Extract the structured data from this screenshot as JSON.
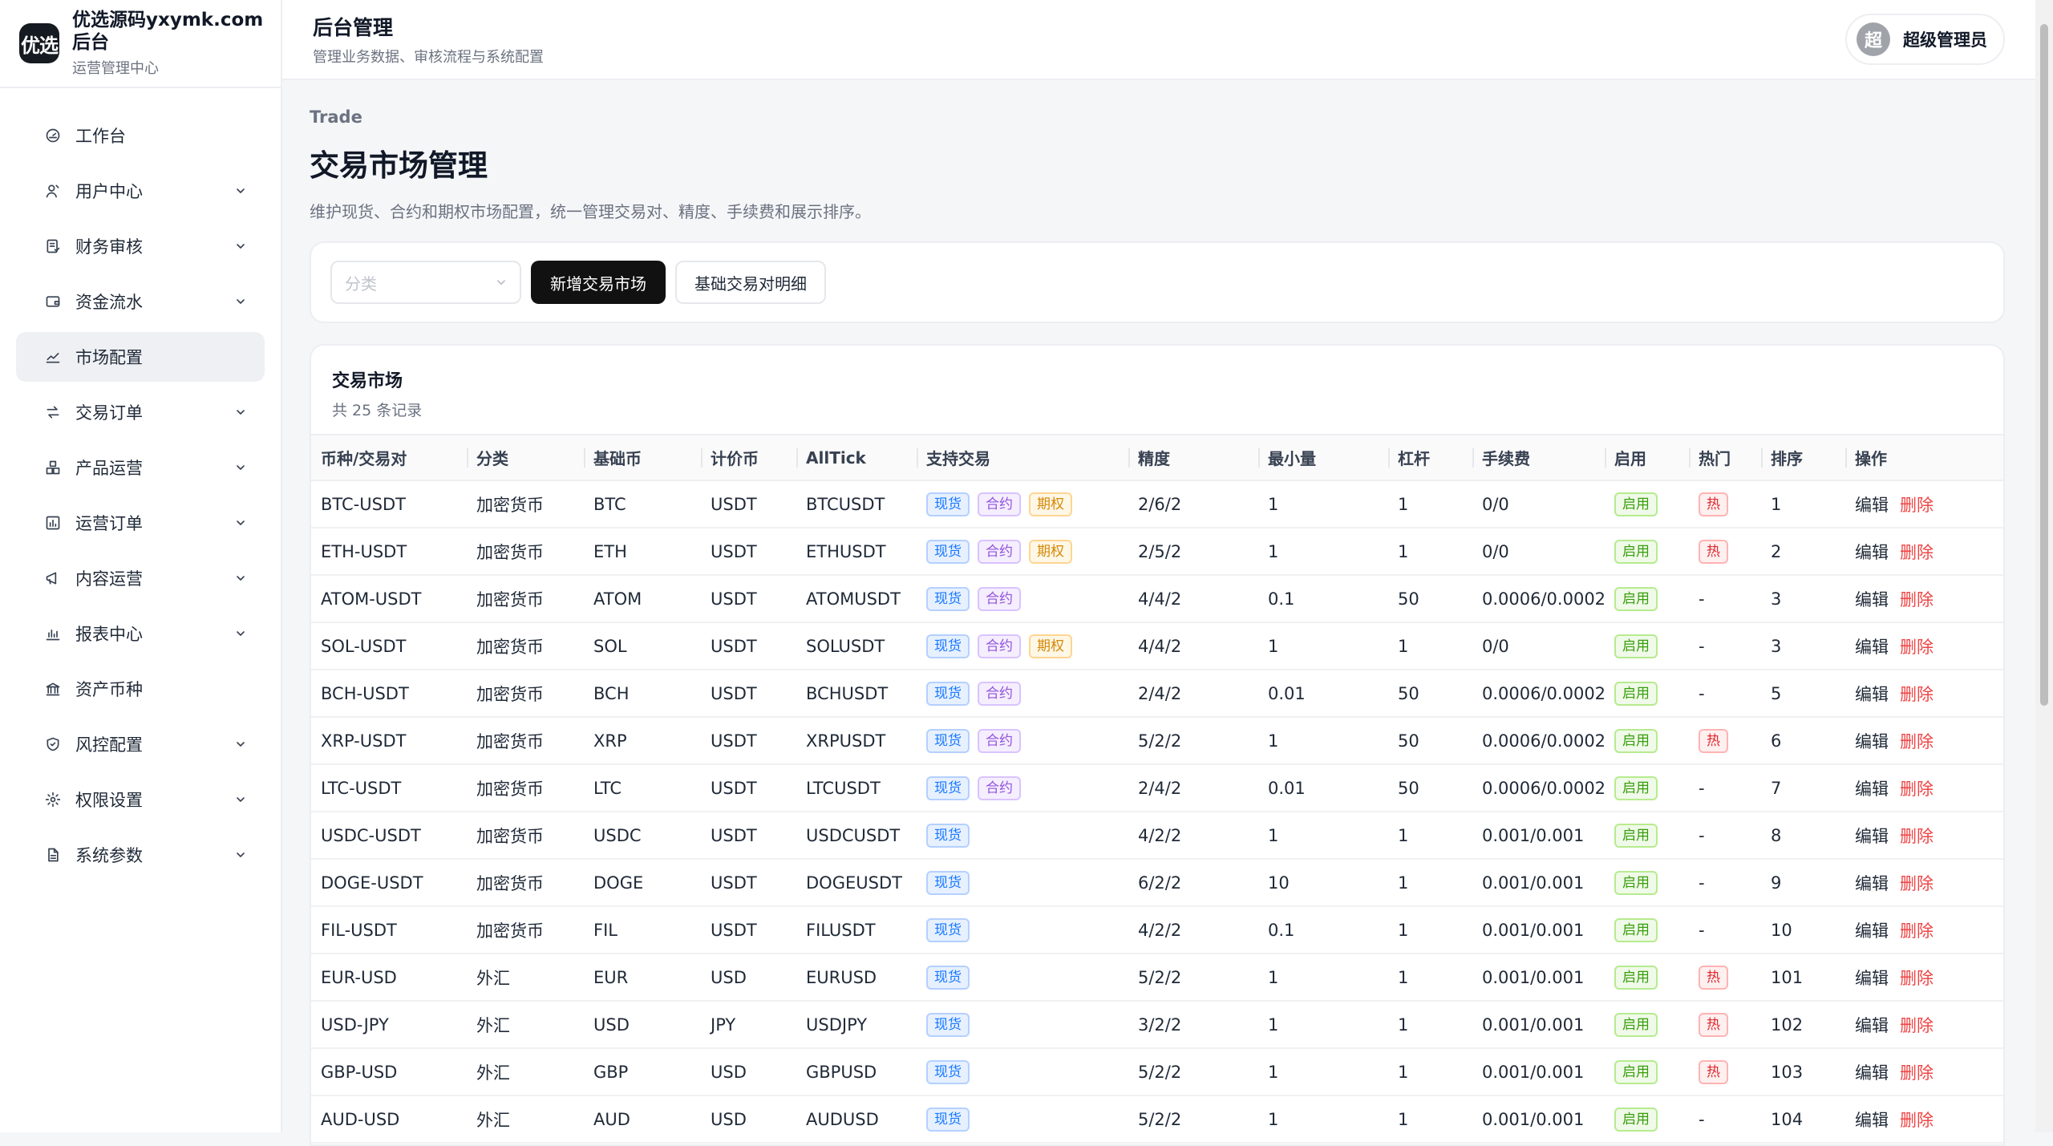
{
  "brand": {
    "logo": "优选",
    "title": "优选源码yxymk.com后台",
    "subtitle": "运营管理中心"
  },
  "nav": [
    {
      "label": "工作台",
      "icon": "dashboard-icon",
      "expandable": false,
      "active": false
    },
    {
      "label": "用户中心",
      "icon": "user-icon",
      "expandable": true,
      "active": false
    },
    {
      "label": "财务审核",
      "icon": "finance-icon",
      "expandable": true,
      "active": false
    },
    {
      "label": "资金流水",
      "icon": "wallet-icon",
      "expandable": true,
      "active": false
    },
    {
      "label": "市场配置",
      "icon": "chart-line-icon",
      "expandable": false,
      "active": true
    },
    {
      "label": "交易订单",
      "icon": "swap-icon",
      "expandable": true,
      "active": false
    },
    {
      "label": "产品运营",
      "icon": "boxes-icon",
      "expandable": true,
      "active": false
    },
    {
      "label": "运营订单",
      "icon": "order-chart-icon",
      "expandable": true,
      "active": false
    },
    {
      "label": "内容运营",
      "icon": "megaphone-icon",
      "expandable": true,
      "active": false
    },
    {
      "label": "报表中心",
      "icon": "bar-chart-icon",
      "expandable": true,
      "active": false
    },
    {
      "label": "资产币种",
      "icon": "bank-icon",
      "expandable": false,
      "active": false
    },
    {
      "label": "风控配置",
      "icon": "shield-icon",
      "expandable": true,
      "active": false
    },
    {
      "label": "权限设置",
      "icon": "gear-icon",
      "expandable": true,
      "active": false
    },
    {
      "label": "系统参数",
      "icon": "document-icon",
      "expandable": true,
      "active": false
    }
  ],
  "topbar": {
    "title": "后台管理",
    "subtitle": "管理业务数据、审核流程与系统配置",
    "avatar": "超",
    "user": "超级管理员"
  },
  "page": {
    "crumb": "Trade",
    "title": "交易市场管理",
    "desc": "维护现货、合约和期权市场配置，统一管理交易对、精度、手续费和展示排序。"
  },
  "toolbar": {
    "category_placeholder": "分类",
    "add_label": "新增交易市场",
    "detail_label": "基础交易对明细"
  },
  "card": {
    "title": "交易市场",
    "count": "共 25 条记录"
  },
  "columns": [
    "币种/交易对",
    "分类",
    "基础币",
    "计价币",
    "AllTick",
    "支持交易",
    "精度",
    "最小量",
    "杠杆",
    "手续费",
    "启用",
    "热门",
    "排序",
    "操作"
  ],
  "labels": {
    "spot": "现货",
    "futures": "合约",
    "options": "期权",
    "enabled": "启用",
    "hot": "热",
    "edit": "编辑",
    "delete": "删除",
    "none": "-"
  },
  "rows": [
    {
      "pair": "BTC-USDT",
      "cat": "加密货币",
      "base": "BTC",
      "quote": "USDT",
      "alltick": "BTCUSDT",
      "trade": [
        "spot",
        "futures",
        "options"
      ],
      "prec": "2/6/2",
      "min": "1",
      "lev": "1",
      "fee": "0/0",
      "hot": true,
      "sort": "1"
    },
    {
      "pair": "ETH-USDT",
      "cat": "加密货币",
      "base": "ETH",
      "quote": "USDT",
      "alltick": "ETHUSDT",
      "trade": [
        "spot",
        "futures",
        "options"
      ],
      "prec": "2/5/2",
      "min": "1",
      "lev": "1",
      "fee": "0/0",
      "hot": true,
      "sort": "2"
    },
    {
      "pair": "ATOM-USDT",
      "cat": "加密货币",
      "base": "ATOM",
      "quote": "USDT",
      "alltick": "ATOMUSDT",
      "trade": [
        "spot",
        "futures"
      ],
      "prec": "4/4/2",
      "min": "0.1",
      "lev": "50",
      "fee": "0.0006/0.0002",
      "hot": false,
      "sort": "3"
    },
    {
      "pair": "SOL-USDT",
      "cat": "加密货币",
      "base": "SOL",
      "quote": "USDT",
      "alltick": "SOLUSDT",
      "trade": [
        "spot",
        "futures",
        "options"
      ],
      "prec": "4/4/2",
      "min": "1",
      "lev": "1",
      "fee": "0/0",
      "hot": false,
      "sort": "3"
    },
    {
      "pair": "BCH-USDT",
      "cat": "加密货币",
      "base": "BCH",
      "quote": "USDT",
      "alltick": "BCHUSDT",
      "trade": [
        "spot",
        "futures"
      ],
      "prec": "2/4/2",
      "min": "0.01",
      "lev": "50",
      "fee": "0.0006/0.0002",
      "hot": false,
      "sort": "5"
    },
    {
      "pair": "XRP-USDT",
      "cat": "加密货币",
      "base": "XRP",
      "quote": "USDT",
      "alltick": "XRPUSDT",
      "trade": [
        "spot",
        "futures"
      ],
      "prec": "5/2/2",
      "min": "1",
      "lev": "50",
      "fee": "0.0006/0.0002",
      "hot": true,
      "sort": "6"
    },
    {
      "pair": "LTC-USDT",
      "cat": "加密货币",
      "base": "LTC",
      "quote": "USDT",
      "alltick": "LTCUSDT",
      "trade": [
        "spot",
        "futures"
      ],
      "prec": "2/4/2",
      "min": "0.01",
      "lev": "50",
      "fee": "0.0006/0.0002",
      "hot": false,
      "sort": "7"
    },
    {
      "pair": "USDC-USDT",
      "cat": "加密货币",
      "base": "USDC",
      "quote": "USDT",
      "alltick": "USDCUSDT",
      "trade": [
        "spot"
      ],
      "prec": "4/2/2",
      "min": "1",
      "lev": "1",
      "fee": "0.001/0.001",
      "hot": false,
      "sort": "8"
    },
    {
      "pair": "DOGE-USDT",
      "cat": "加密货币",
      "base": "DOGE",
      "quote": "USDT",
      "alltick": "DOGEUSDT",
      "trade": [
        "spot"
      ],
      "prec": "6/2/2",
      "min": "10",
      "lev": "1",
      "fee": "0.001/0.001",
      "hot": false,
      "sort": "9"
    },
    {
      "pair": "FIL-USDT",
      "cat": "加密货币",
      "base": "FIL",
      "quote": "USDT",
      "alltick": "FILUSDT",
      "trade": [
        "spot"
      ],
      "prec": "4/2/2",
      "min": "0.1",
      "lev": "1",
      "fee": "0.001/0.001",
      "hot": false,
      "sort": "10"
    },
    {
      "pair": "EUR-USD",
      "cat": "外汇",
      "base": "EUR",
      "quote": "USD",
      "alltick": "EURUSD",
      "trade": [
        "spot"
      ],
      "prec": "5/2/2",
      "min": "1",
      "lev": "1",
      "fee": "0.001/0.001",
      "hot": true,
      "sort": "101"
    },
    {
      "pair": "USD-JPY",
      "cat": "外汇",
      "base": "USD",
      "quote": "JPY",
      "alltick": "USDJPY",
      "trade": [
        "spot"
      ],
      "prec": "3/2/2",
      "min": "1",
      "lev": "1",
      "fee": "0.001/0.001",
      "hot": true,
      "sort": "102"
    },
    {
      "pair": "GBP-USD",
      "cat": "外汇",
      "base": "GBP",
      "quote": "USD",
      "alltick": "GBPUSD",
      "trade": [
        "spot"
      ],
      "prec": "5/2/2",
      "min": "1",
      "lev": "1",
      "fee": "0.001/0.001",
      "hot": true,
      "sort": "103"
    },
    {
      "pair": "AUD-USD",
      "cat": "外汇",
      "base": "AUD",
      "quote": "USD",
      "alltick": "AUDUSD",
      "trade": [
        "spot"
      ],
      "prec": "5/2/2",
      "min": "1",
      "lev": "1",
      "fee": "0.001/0.001",
      "hot": false,
      "sort": "104"
    }
  ]
}
